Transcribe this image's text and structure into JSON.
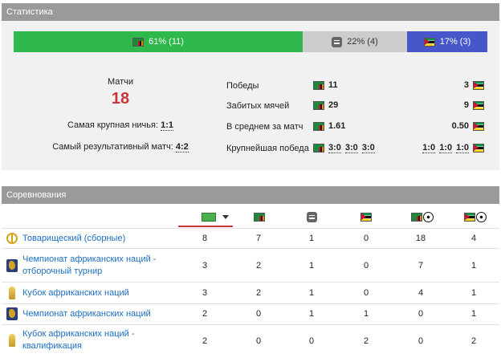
{
  "stats_panel": {
    "title": "Статистика",
    "outcome_bar": {
      "wins": {
        "label": "61% (11)",
        "fraction": 0.61,
        "color": "#2fb84b"
      },
      "draws": {
        "label": "22% (4)",
        "fraction": 0.22,
        "color": "#cccccc"
      },
      "losses": {
        "label": "17% (3)",
        "fraction": 0.17,
        "color": "#4757c9"
      }
    },
    "summary": {
      "matches_label": "Матчи",
      "matches_count": "18",
      "biggest_draw_label": "Самая крупная ничья:",
      "biggest_draw_value": "1:1",
      "highest_scoring_label": "Самый результативный матч:",
      "highest_scoring_value": "4:2"
    },
    "rows": [
      {
        "label": "Победы",
        "left": "11",
        "right": "3"
      },
      {
        "label": "Забитых мячей",
        "left": "29",
        "right": "9"
      },
      {
        "label": "В среднем за матч",
        "left": "1.61",
        "right": "0.50"
      },
      {
        "label": "Крупнейшая победа",
        "left": [
          "3:0",
          "3:0",
          "3:0"
        ],
        "right": [
          "1:0",
          "1:0",
          "1:0"
        ]
      }
    ]
  },
  "competitions_panel": {
    "title": "Соревнования",
    "headers": [
      "matches-sort",
      "zambia-wins",
      "draws",
      "mozambique-wins",
      "zambia-goals",
      "mozambique-goals"
    ],
    "rows": [
      {
        "icon": "peace-icon",
        "name": [
          "Товарищеский (сборные)"
        ],
        "values": [
          "8",
          "7",
          "1",
          "0",
          "18",
          "4"
        ]
      },
      {
        "icon": "african-nations-championship-icon",
        "name": [
          "Чемпионат африканских наций -",
          "отборочный турнир"
        ],
        "values": [
          "3",
          "2",
          "1",
          "0",
          "7",
          "1"
        ]
      },
      {
        "icon": "trophy-icon",
        "name": [
          "Кубок африканских наций"
        ],
        "values": [
          "3",
          "2",
          "1",
          "0",
          "4",
          "1"
        ]
      },
      {
        "icon": "african-nations-championship-icon",
        "name": [
          "Чемпионат африканских наций"
        ],
        "values": [
          "2",
          "0",
          "1",
          "1",
          "0",
          "1"
        ]
      },
      {
        "icon": "trophy-icon",
        "name": [
          "Кубок африканских наций -",
          "квалификация"
        ],
        "values": [
          "2",
          "0",
          "0",
          "2",
          "0",
          "2"
        ]
      }
    ]
  },
  "colors": {
    "accent_red": "#c8363a",
    "link_blue": "#1e6fc0",
    "header_gray": "#9a9a9a"
  }
}
